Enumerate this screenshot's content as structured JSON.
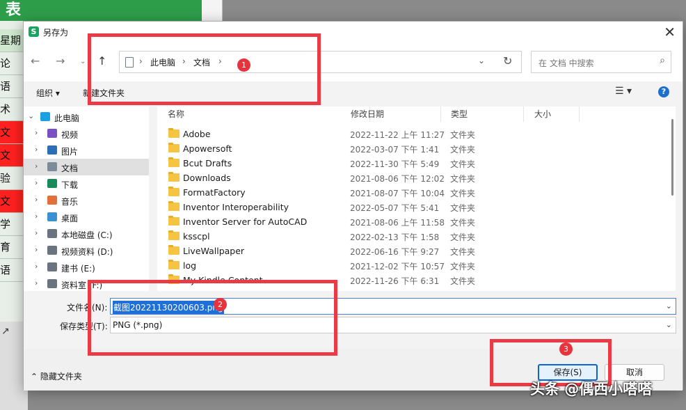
{
  "background": {
    "header_text": "表",
    "cells": [
      {
        "text": "星期",
        "color": "green"
      },
      {
        "text": "论",
        "color": "none"
      },
      {
        "text": "语",
        "color": "none"
      },
      {
        "text": "术",
        "color": "none"
      },
      {
        "text": "文",
        "color": "red"
      },
      {
        "text": "文",
        "color": "red"
      },
      {
        "text": "验",
        "color": "none"
      },
      {
        "text": "文",
        "color": "red"
      },
      {
        "text": "学",
        "color": "none"
      },
      {
        "text": "育",
        "color": "none"
      },
      {
        "text": "语",
        "color": "none"
      }
    ]
  },
  "dialog": {
    "app_icon": "S",
    "title": "另存为",
    "breadcrumb": [
      "此电脑",
      "文档"
    ],
    "search_placeholder": "在 文档 中搜索",
    "toolbar": {
      "organize": "组织 ▾",
      "new_folder": "新建文件夹"
    },
    "nav_tree": [
      {
        "label": "此电脑",
        "icon": "monitor-icon",
        "color": "#1ba1e2",
        "chevron": "⌄",
        "indent": 0,
        "selected": false
      },
      {
        "label": "视频",
        "icon": "video-icon",
        "color": "#7b4fc4",
        "chevron": "›",
        "indent": 1,
        "selected": false
      },
      {
        "label": "图片",
        "icon": "picture-icon",
        "color": "#2c6fb7",
        "chevron": "›",
        "indent": 1,
        "selected": false
      },
      {
        "label": "文档",
        "icon": "document-icon",
        "color": "#7c8b9a",
        "chevron": "›",
        "indent": 1,
        "selected": true
      },
      {
        "label": "下载",
        "icon": "download-icon",
        "color": "#1b8a5a",
        "chevron": "›",
        "indent": 1,
        "selected": false
      },
      {
        "label": "音乐",
        "icon": "music-icon",
        "color": "#e36f3a",
        "chevron": "›",
        "indent": 1,
        "selected": false
      },
      {
        "label": "桌面",
        "icon": "desktop-icon",
        "color": "#3a90d0",
        "chevron": "›",
        "indent": 1,
        "selected": false
      },
      {
        "label": "本地磁盘 (C:)",
        "icon": "drive-icon",
        "color": "#6a7480",
        "chevron": "›",
        "indent": 1,
        "selected": false
      },
      {
        "label": "视频资料 (D:)",
        "icon": "drive-icon",
        "color": "#6a7480",
        "chevron": "›",
        "indent": 1,
        "selected": false
      },
      {
        "label": "建书 (E:)",
        "icon": "drive-icon",
        "color": "#6a7480",
        "chevron": "›",
        "indent": 1,
        "selected": false
      },
      {
        "label": "资料室 (F:)",
        "icon": "drive-icon",
        "color": "#6a7480",
        "chevron": "›",
        "indent": 1,
        "selected": false
      }
    ],
    "columns": [
      "名称",
      "修改日期",
      "类型",
      "大小"
    ],
    "files": [
      {
        "name": "Adobe",
        "date": "2022-11-22 上午 11:27",
        "type": "文件夹"
      },
      {
        "name": "Apowersoft",
        "date": "2022-03-07 下午 1:41",
        "type": "文件夹"
      },
      {
        "name": "Bcut Drafts",
        "date": "2022-11-30 下午 5:49",
        "type": "文件夹"
      },
      {
        "name": "Downloads",
        "date": "2021-08-06 下午 12:02",
        "type": "文件夹"
      },
      {
        "name": "FormatFactory",
        "date": "2021-08-07 下午 10:04",
        "type": "文件夹"
      },
      {
        "name": "Inventor Interoperability",
        "date": "2022-05-07 下午 5:41",
        "type": "文件夹"
      },
      {
        "name": "Inventor Server for AutoCAD",
        "date": "2021-08-06 上午 11:58",
        "type": "文件夹"
      },
      {
        "name": "ksscpl",
        "date": "2022-02-13 下午 1:58",
        "type": "文件夹"
      },
      {
        "name": "LiveWallpaper",
        "date": "2022-06-16 下午 9:27",
        "type": "文件夹"
      },
      {
        "name": "log",
        "date": "2021-12-02 下午 10:57",
        "type": "文件夹"
      },
      {
        "name": "My Kindle Content",
        "date": "2022-11-26 下午 6:31",
        "type": "文件夹"
      }
    ],
    "filename_label": "文件名(N):",
    "filename_value": "截图20221130200603.png",
    "filetype_label": "保存类型(T):",
    "filetype_value": "PNG (*.png)",
    "hide_folders": "隐藏文件夹",
    "save_label": "保存(S)",
    "cancel_label": "取消"
  },
  "annotations": [
    "1",
    "2",
    "3"
  ],
  "watermark": "头条 @偶西小嗒嗒"
}
